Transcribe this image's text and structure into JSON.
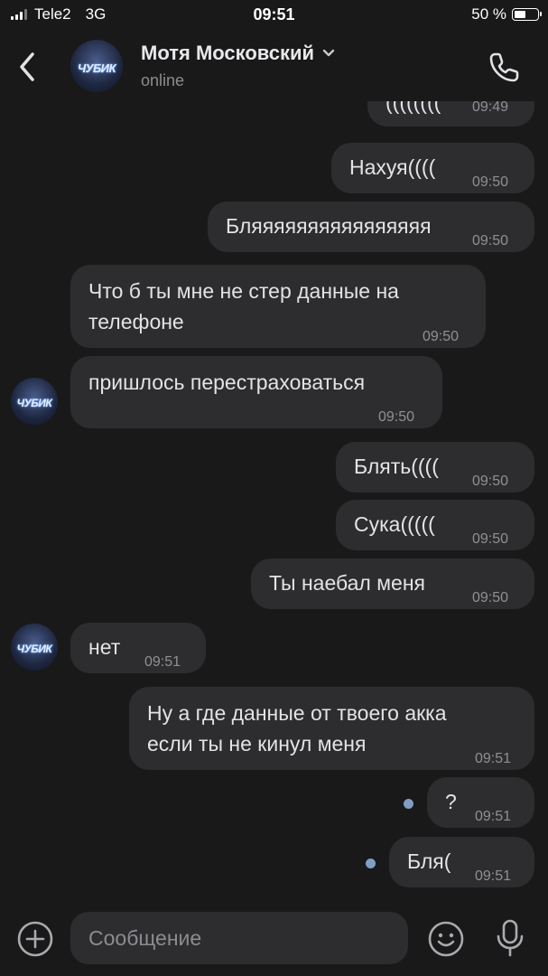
{
  "status_bar": {
    "carrier": "Tele2",
    "network": "3G",
    "time": "09:51",
    "battery": "50 %",
    "battery_level": 0.5
  },
  "header": {
    "contact_name": "Мотя Московский",
    "status": "online",
    "avatar_text": "ЧУБИК"
  },
  "messages": [
    {
      "id": "m1",
      "side": "out",
      "text": "((((((((",
      "time": "09:49"
    },
    {
      "id": "m2",
      "side": "out",
      "text": "Нахуя((((",
      "time": "09:50"
    },
    {
      "id": "m3",
      "side": "out",
      "text": "Бляяяяяяяяяяяяяяяя",
      "time": "09:50"
    },
    {
      "id": "m4",
      "side": "in",
      "line1": "Что б ты мне не стер данные на",
      "line2": "телефоне",
      "time": "09:50"
    },
    {
      "id": "m5",
      "side": "in",
      "text": "пришлось перестраховаться",
      "time": "09:50"
    },
    {
      "id": "m6",
      "side": "out",
      "text": "Блять((((",
      "time": "09:50"
    },
    {
      "id": "m7",
      "side": "out",
      "text": "Сука(((((",
      "time": "09:50"
    },
    {
      "id": "m8",
      "side": "out",
      "text": "Ты наебал меня",
      "time": "09:50"
    },
    {
      "id": "m9",
      "side": "in",
      "text": "нет",
      "time": "09:51"
    },
    {
      "id": "m10",
      "side": "out",
      "line1": "Ну а где данные от твоего акка",
      "line2": "если ты не кинул меня",
      "time": "09:51"
    },
    {
      "id": "m11",
      "side": "out",
      "text": "?",
      "time": "09:51",
      "unread": true
    },
    {
      "id": "m12",
      "side": "out",
      "text": "Бля(",
      "time": "09:51",
      "unread": true
    }
  ],
  "composer": {
    "placeholder": "Сообщение"
  },
  "colors": {
    "background": "#19191a",
    "bubble": "#2d2d2f",
    "unread_dot": "#7f9ec2",
    "text": "#e2e3e6",
    "meta": "#8e9094"
  },
  "icons": [
    "back-chevron-icon",
    "chevron-down-icon",
    "phone-icon",
    "plus-circle-icon",
    "emoji-icon",
    "microphone-icon"
  ]
}
